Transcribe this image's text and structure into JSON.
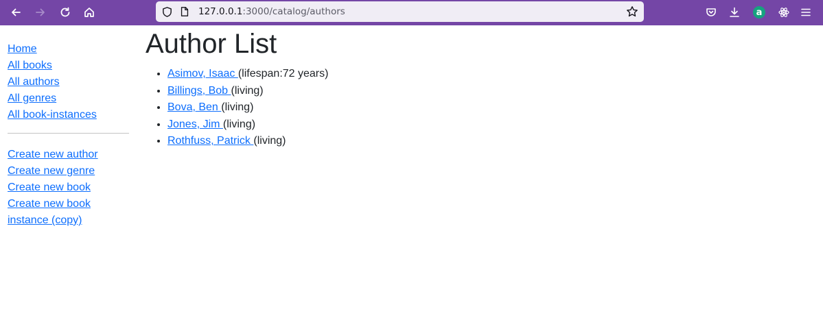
{
  "browser": {
    "url_host": "127.0.0.1",
    "url_rest": ":3000/catalog/authors",
    "toolbar_color": "#7446a6"
  },
  "sidebar": {
    "nav": [
      {
        "label": "Home"
      },
      {
        "label": "All books"
      },
      {
        "label": "All authors"
      },
      {
        "label": "All genres"
      },
      {
        "label": "All book-instances"
      }
    ],
    "create": [
      {
        "label": "Create new author"
      },
      {
        "label": "Create new genre"
      },
      {
        "label": "Create new book"
      },
      {
        "label": "Create new book instance (copy)"
      }
    ]
  },
  "main": {
    "title": "Author List",
    "authors": [
      {
        "name": "Asimov, Isaac ",
        "info": "(lifespan:72 years)"
      },
      {
        "name": "Billings, Bob ",
        "info": "(living)"
      },
      {
        "name": "Bova, Ben ",
        "info": "(living)"
      },
      {
        "name": "Jones, Jim ",
        "info": "(living)"
      },
      {
        "name": "Rothfuss, Patrick ",
        "info": "(living)"
      }
    ]
  }
}
